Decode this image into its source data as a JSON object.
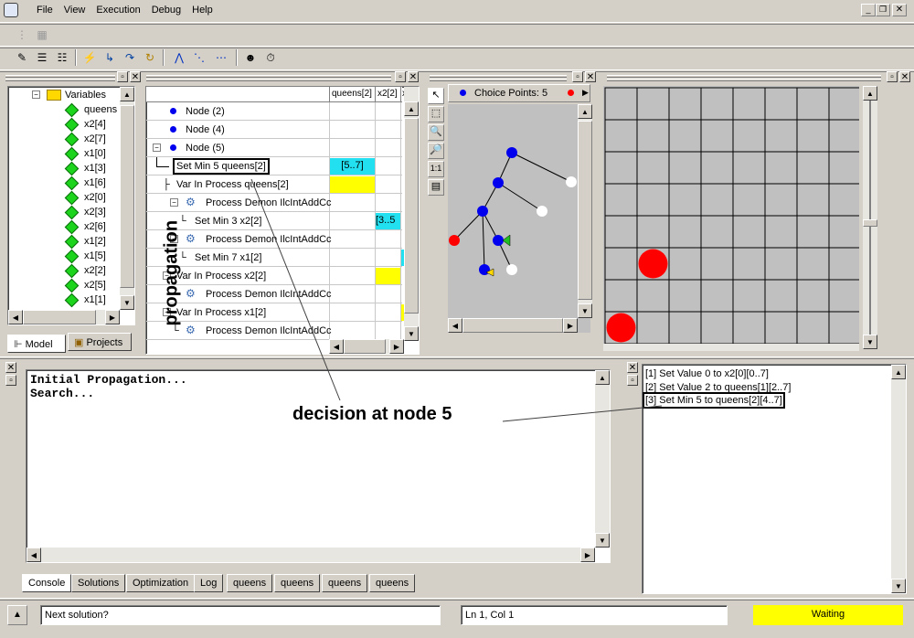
{
  "menu": [
    "File",
    "View",
    "Execution",
    "Debug",
    "Help"
  ],
  "model_tree": {
    "root": "Variables",
    "items": [
      "queens",
      "x2[4]",
      "x2[7]",
      "x1[0]",
      "x1[3]",
      "x1[6]",
      "x2[0]",
      "x2[3]",
      "x2[6]",
      "x1[2]",
      "x1[5]",
      "x2[2]",
      "x2[5]",
      "x1[1]"
    ]
  },
  "left_tabs": [
    "Model",
    "Projects"
  ],
  "propagation": {
    "label": "propagation",
    "columns": [
      "queens[2]",
      "x2[2]",
      "x"
    ],
    "rows": [
      {
        "text": "Node (2)",
        "cell": ""
      },
      {
        "text": "Node (4)",
        "cell": ""
      },
      {
        "text": "Node (5)",
        "cell": ""
      },
      {
        "text": "Set Min 5 queens[2]",
        "cell": "[5..7]"
      },
      {
        "text": "Var In Process queens[2]",
        "cell": ""
      },
      {
        "text": "Process Demon  IlcIntAddCc",
        "cell": ""
      },
      {
        "text": "Set Min 3 x2[2]",
        "cell": "[3..5"
      },
      {
        "text": "Process Demon  IlcIntAddCc",
        "cell": ""
      },
      {
        "text": "Set Min 7 x1[2]",
        "cell": ""
      },
      {
        "text": "Var In Process x2[2]",
        "cell": ""
      },
      {
        "text": "Process Demon  IlcIntAddCc",
        "cell": ""
      },
      {
        "text": "Var In Process x1[2]",
        "cell": ""
      },
      {
        "text": "Process Demon  IlcIntAddCc",
        "cell": ""
      }
    ]
  },
  "choice_points": {
    "label": "Choice Points: 5"
  },
  "tree_scale": "1:1",
  "console": {
    "line1": "Initial Propagation...",
    "line2": "Search..."
  },
  "annotation": "decision at node 5",
  "decisions": [
    "[1] Set Value 0 to x2[0][0..7]",
    "[2] Set Value 2 to queens[1][2..7]",
    "[3] Set Min 5 to queens[2][4..7]"
  ],
  "bottom_tabs": [
    "Console",
    "Solutions",
    "Optimization",
    "Log",
    "queens",
    "queens",
    "queens",
    "queens"
  ],
  "status": {
    "prompt": "Next solution?",
    "position": "Ln 1, Col 1",
    "state": "Waiting"
  },
  "colors": {
    "cyan": "#22e0f0",
    "yellow": "#ffff00",
    "queen": "#ff0000",
    "node_blue": "#0000ee",
    "status_yellow": "#ffff00"
  },
  "board": {
    "rows": 8,
    "cols": 8,
    "queens": [
      {
        "row": 5,
        "col": 1
      },
      {
        "row": 7,
        "col": 0
      }
    ]
  }
}
